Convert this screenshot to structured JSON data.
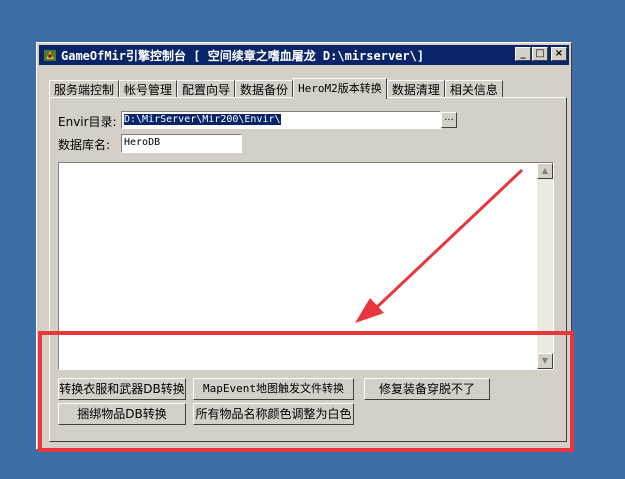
{
  "window": {
    "title": "GameOfMir引擎控制台 [  空间续章之嗜血屠龙   D:\\mirserver\\]",
    "controls": {
      "minimize": "_",
      "maximize": "□",
      "close": "×"
    }
  },
  "tabs": [
    {
      "label": "服务端控制"
    },
    {
      "label": "帐号管理"
    },
    {
      "label": "配置向导"
    },
    {
      "label": "数据备份"
    },
    {
      "label": "HeroM2版本转换"
    },
    {
      "label": "数据清理"
    },
    {
      "label": "相关信息"
    }
  ],
  "form": {
    "envir_label": "Envir目录:",
    "envir_value": "D:\\MirServer\\Mir200\\Envir\\",
    "browse_label": "...",
    "dbname_label": "数据库名:",
    "dbname_value": "HeroDB"
  },
  "buttons": {
    "convert_clothes_weapons": "转换衣服和武器DB转换",
    "bind_items": "捆绑物品DB转换",
    "mapevent": "MapEvent地图触发文件转换",
    "item_color": "所有物品名称颜色调整为白色",
    "repair_equip": "修复装备穿脱不了"
  },
  "annotation": {
    "color": "#e8373c"
  }
}
